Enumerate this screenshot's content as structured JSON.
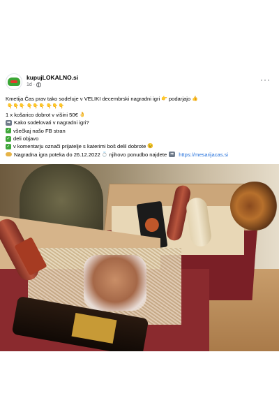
{
  "post": {
    "author": "kupujLOKALNO.si",
    "time": "1d",
    "more_label": "···",
    "lines": [
      "Kmetija Čas prav tako sodeluje v VELIKI decembrski nagradni igri",
      "podarjajo",
      "1 x košarico dobrot v višini 50€",
      "Kako sodelovati v nagradni igri?",
      "všečkaj našo FB stran",
      "deli objavo",
      "v komentarju označi prijatelje s katerimi boš delil dobrote",
      "Nagradna igra poteka do 26.12.2022",
      "njihovo ponudbo najdete",
      "https://mesarijacas.si"
    ]
  },
  "icons": {
    "avatar": "kupujlokalno-logo",
    "globe": "globe-icon",
    "more": "more-options-icon",
    "hand": "pointing-hand-emoji",
    "check": "check-mark-emoji",
    "arrow": "right-arrow-emoji"
  }
}
